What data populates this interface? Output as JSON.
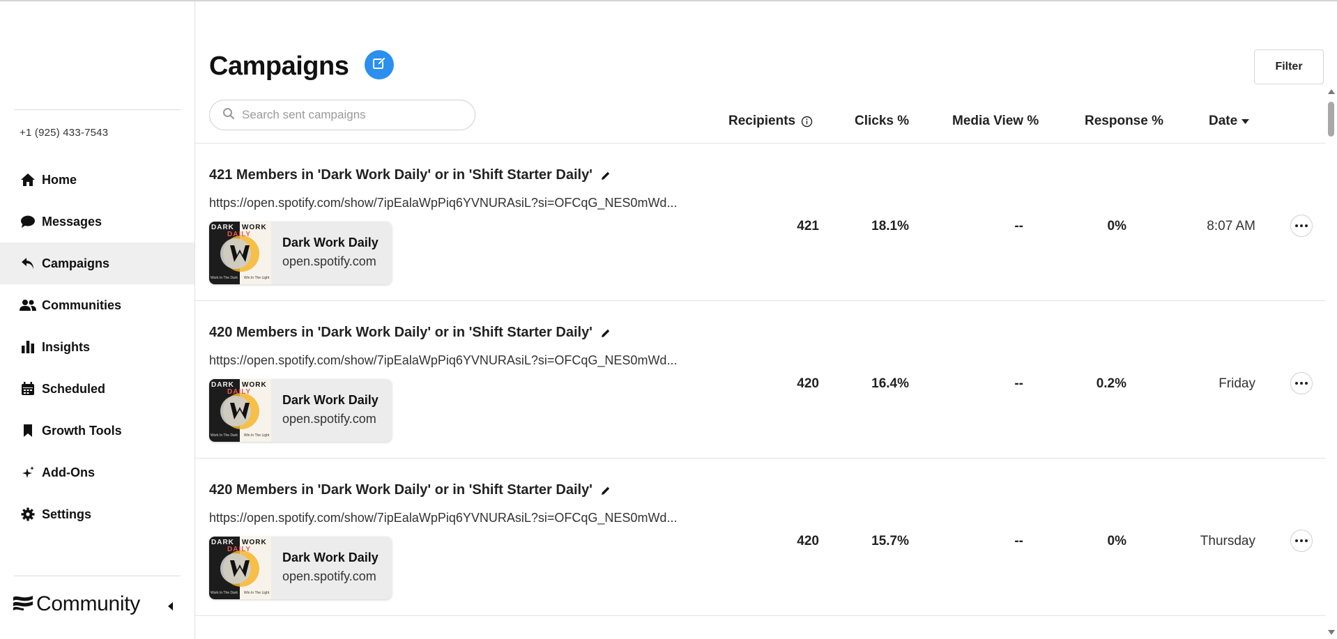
{
  "account": {
    "phone": "+1 (925) 433-7543"
  },
  "sidebar": {
    "items": [
      {
        "label": "Home",
        "icon": "home-icon"
      },
      {
        "label": "Messages",
        "icon": "chat-bubble-icon"
      },
      {
        "label": "Campaigns",
        "icon": "reply-icon",
        "active": true
      },
      {
        "label": "Communities",
        "icon": "people-icon"
      },
      {
        "label": "Insights",
        "icon": "bar-chart-icon"
      },
      {
        "label": "Scheduled",
        "icon": "calendar-icon"
      },
      {
        "label": "Growth Tools",
        "icon": "bookmark-icon"
      },
      {
        "label": "Add-Ons",
        "icon": "sparkle-icon"
      },
      {
        "label": "Settings",
        "icon": "gear-icon"
      }
    ],
    "brand": "Community"
  },
  "page": {
    "title": "Campaigns",
    "filter_label": "Filter",
    "search_placeholder": "Search sent campaigns"
  },
  "columns": {
    "recipients": "Recipients",
    "clicks": "Clicks %",
    "media_view": "Media View %",
    "response": "Response %",
    "date": "Date"
  },
  "campaigns": [
    {
      "title": "421 Members in 'Dark Work Daily' or in 'Shift Starter Daily'",
      "url": "https://open.spotify.com/show/7ipEalaWpPiq6YVNURAsiL?si=OFCqG_NES0mWd...",
      "card_title": "Dark Work Daily",
      "card_domain": "open.spotify.com",
      "recipients": "421",
      "clicks": "18.1%",
      "media_view": "--",
      "response": "0%",
      "date": "8:07 AM"
    },
    {
      "title": "420 Members in 'Dark Work Daily' or in 'Shift Starter Daily'",
      "url": "https://open.spotify.com/show/7ipEalaWpPiq6YVNURAsiL?si=OFCqG_NES0mWd...",
      "card_title": "Dark Work Daily",
      "card_domain": "open.spotify.com",
      "recipients": "420",
      "clicks": "16.4%",
      "media_view": "--",
      "response": "0.2%",
      "date": "Friday"
    },
    {
      "title": "420 Members in 'Dark Work Daily' or in 'Shift Starter Daily'",
      "url": "https://open.spotify.com/show/7ipEalaWpPiq6YVNURAsiL?si=OFCqG_NES0mWd...",
      "card_title": "Dark Work Daily",
      "card_domain": "open.spotify.com",
      "recipients": "420",
      "clicks": "15.7%",
      "media_view": "--",
      "response": "0%",
      "date": "Thursday"
    }
  ],
  "colors": {
    "accent": "#2b8ff0",
    "active_bg": "#efefef",
    "thumb_gold": "#f6b52c"
  }
}
